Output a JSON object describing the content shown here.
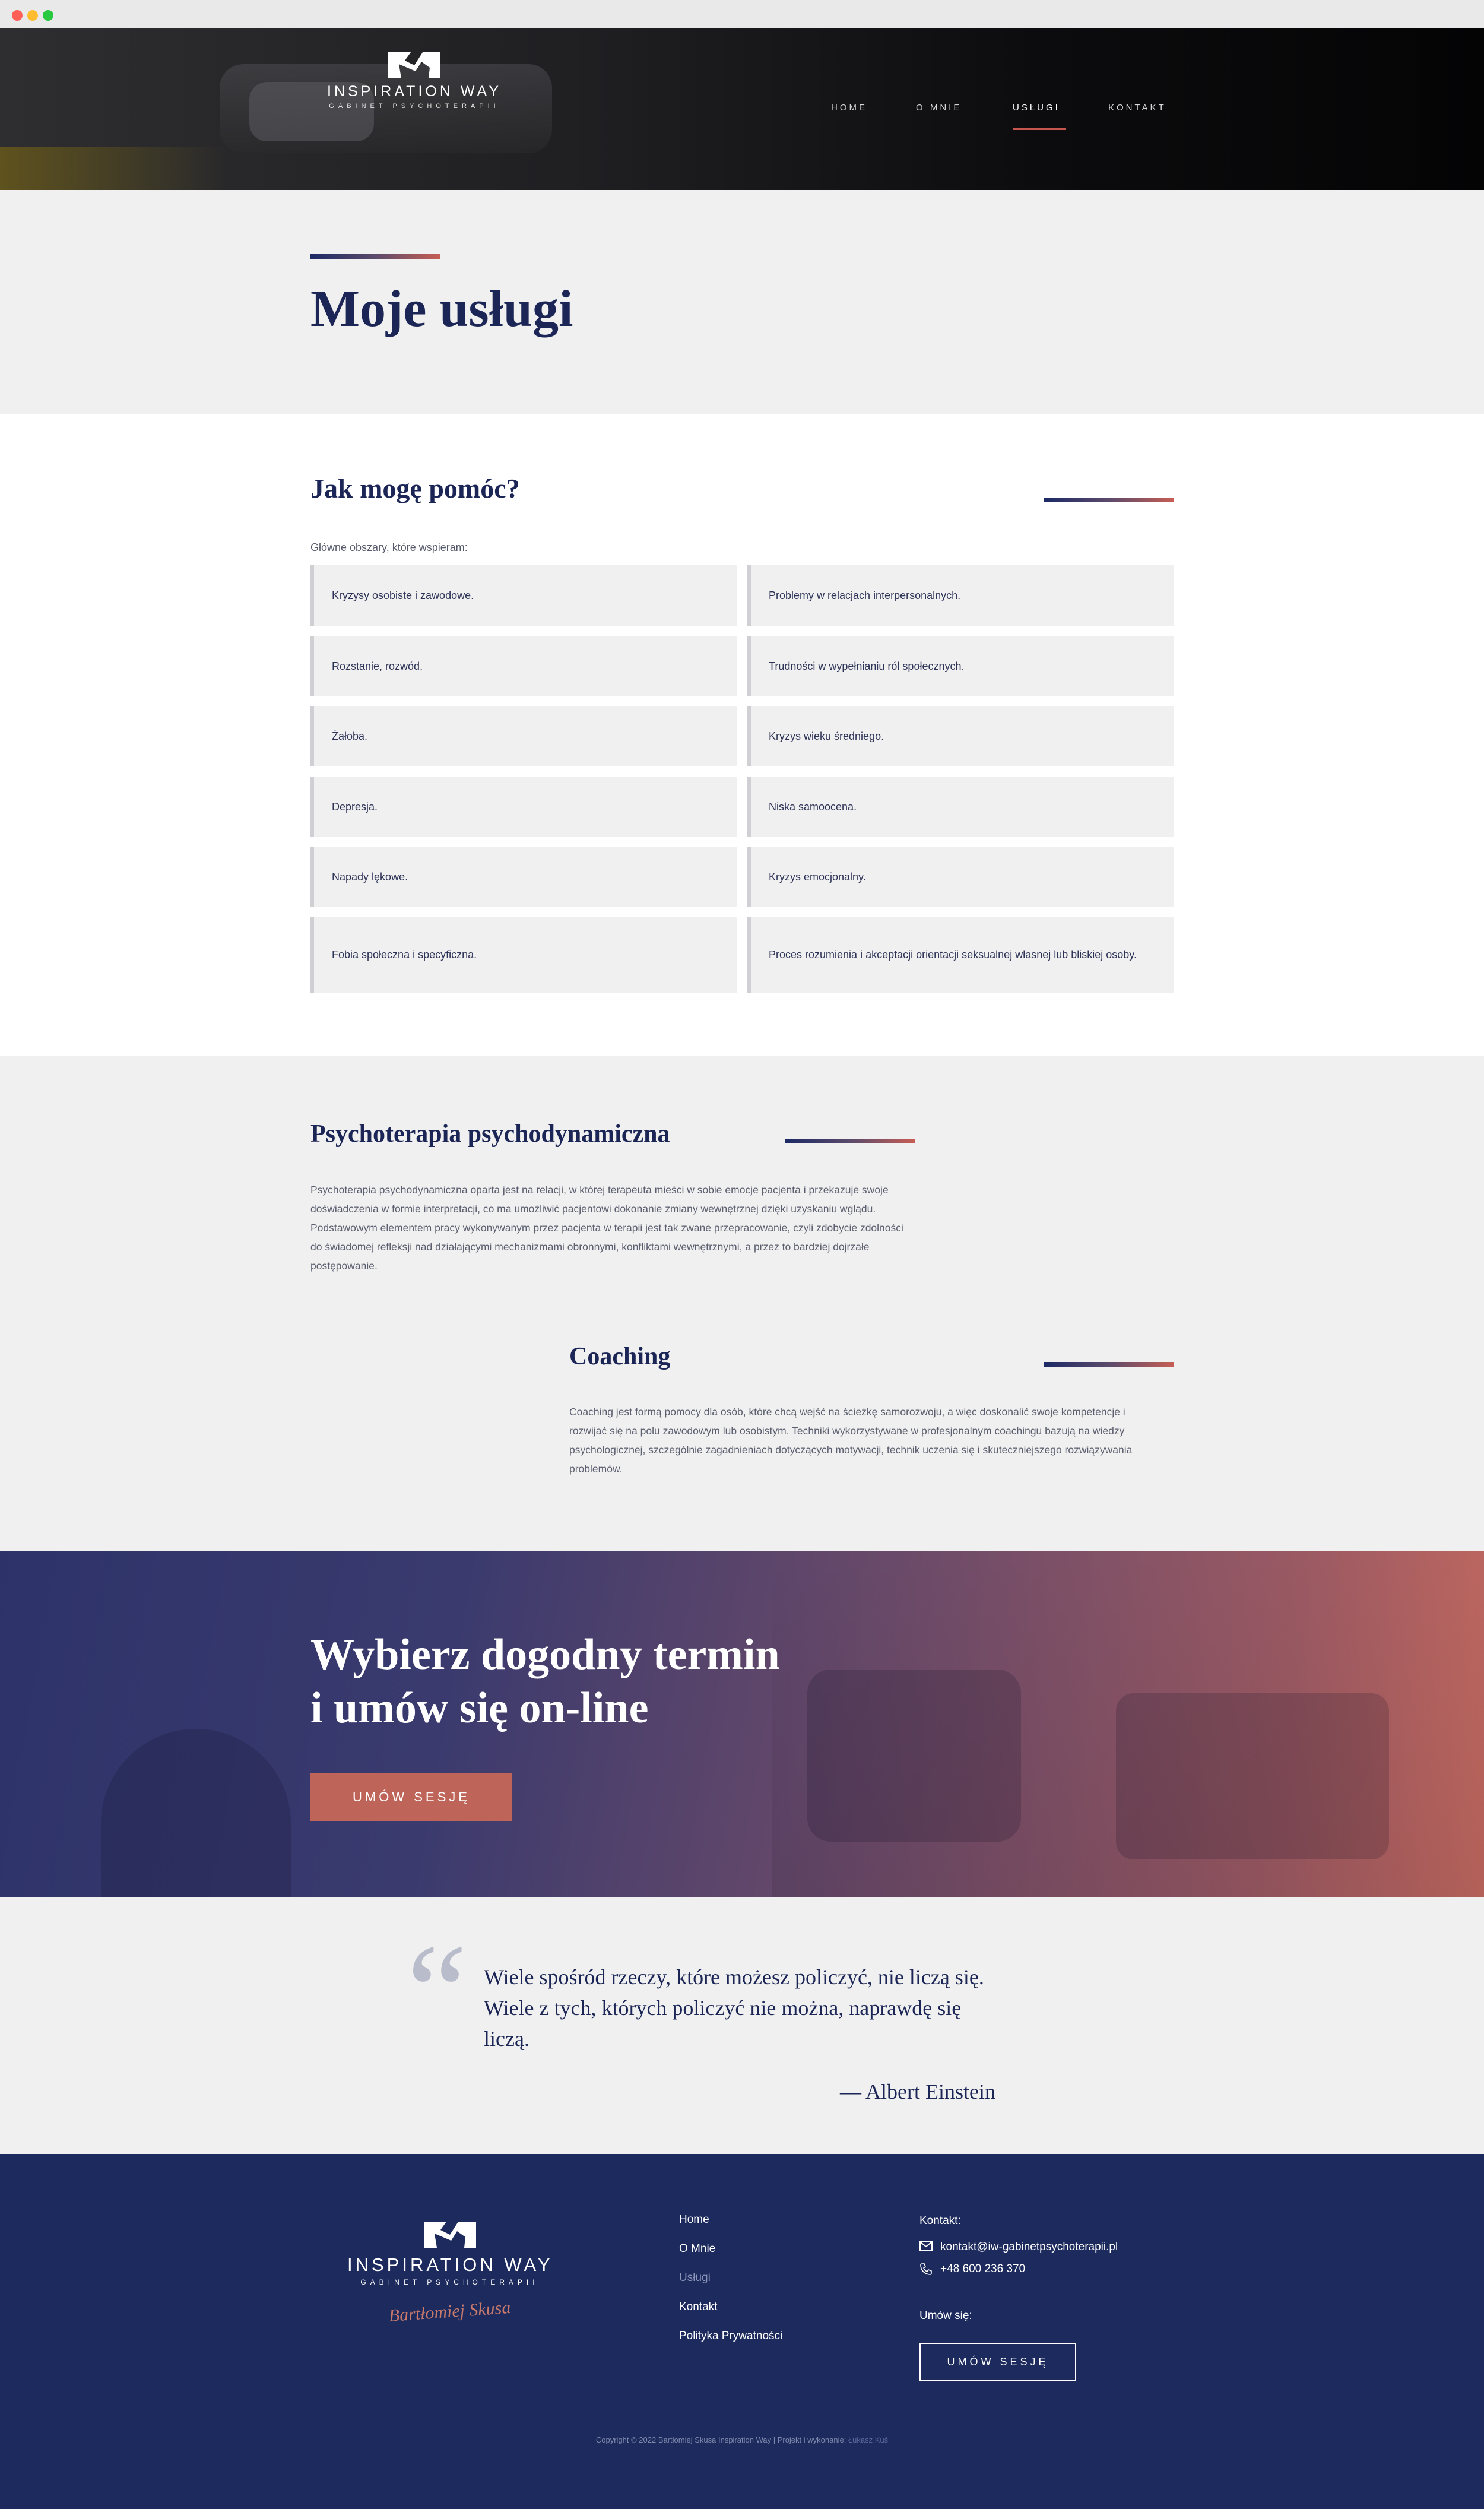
{
  "browser": {
    "dot_colors": [
      "#fe5f57",
      "#febc2e",
      "#28c840"
    ]
  },
  "header": {
    "brand": "INSPIRATION WAY",
    "brand_sub": "GABINET PSYCHOTERAPII",
    "nav": [
      {
        "label": "HOME",
        "active": false
      },
      {
        "label": "O MNIE",
        "active": false
      },
      {
        "label": "USŁUGI",
        "active": true
      },
      {
        "label": "KONTAKT",
        "active": false
      }
    ]
  },
  "page": {
    "title": "Moje usługi"
  },
  "services": {
    "heading": "Jak mogę pomóc?",
    "lead": "Główne obszary, które wspieram:",
    "items": [
      "Kryzysy osobiste i zawodowe.",
      "Problemy w relacjach interpersonalnych.",
      "Rozstanie, rozwód.",
      "Trudności w wypełnianiu ról społecznych.",
      "Żałoba.",
      "Kryzys wieku średniego.",
      "Depresja.",
      "Niska samoocena.",
      "Napady lękowe.",
      "Kryzys emocjonalny.",
      "Fobia społeczna i specyficzna.",
      "Proces rozumienia i akceptacji orientacji seksualnej własnej lub bliskiej osoby."
    ]
  },
  "therapy": {
    "heading": "Psychoterapia psychodynamiczna",
    "text": "Psychoterapia psychodynamiczna oparta jest na relacji, w której terapeuta mieści w sobie emocje pacjenta i przekazuje swoje doświadczenia w formie interpretacji, co ma umożliwić pacjentowi dokonanie zmiany wewnętrznej dzięki uzyskaniu wglądu. Podstawowym elementem pracy wykonywanym przez pacjenta w terapii jest tak zwane przepracowanie, czyli zdobycie zdolności do świadomej refleksji nad działającymi mechanizmami obronnymi, konfliktami wewnętrznymi, a przez to bardziej dojrzałe postępowanie."
  },
  "coaching": {
    "heading": "Coaching",
    "text": "Coaching jest formą pomocy dla osób, które chcą wejść na ścieżkę samorozwoju, a więc doskonalić swoje kompetencje i rozwijać się na polu zawodowym lub osobistym. Techniki wykorzystywane w profesjonalnym coachingu bazują na wiedzy psychologicznej, szczególnie zagadnieniach dotyczących motywacji, technik uczenia się i skuteczniejszego rozwiązywania problemów."
  },
  "cta": {
    "title_line1": "Wybierz dogodny termin",
    "title_line2": "i umów się on-line",
    "button": "UMÓW SESJĘ"
  },
  "quote": {
    "mark": "“",
    "text": "Wiele spośród rzeczy, które możesz policzyć, nie liczą się. Wiele z tych, których policzyć nie można, naprawdę się liczą.",
    "author": "— Albert Einstein"
  },
  "footer": {
    "brand": "INSPIRATION WAY",
    "brand_sub": "GABINET PSYCHOTERAPII",
    "signature": "Bartłomiej Skusa",
    "links": [
      "Home",
      "O Mnie",
      "Usługi",
      "Kontakt",
      "Polityka Prywatności"
    ],
    "contact_label": "Kontakt:",
    "email": "kontakt@iw-gabinetpsychoterapii.pl",
    "phone": "+48 600 236 370",
    "book_label": "Umów się:",
    "button": "UMÓW SESJĘ",
    "copyright": "Copyright © 2022 Bartłomiej Skusa Inspiration Way | Projekt i wykonanie:",
    "author_link": "Łukasz Kuś"
  },
  "colors": {
    "navy": "#1c2656",
    "accent": "#c65d55",
    "footer_bg": "#1c2a5d"
  }
}
